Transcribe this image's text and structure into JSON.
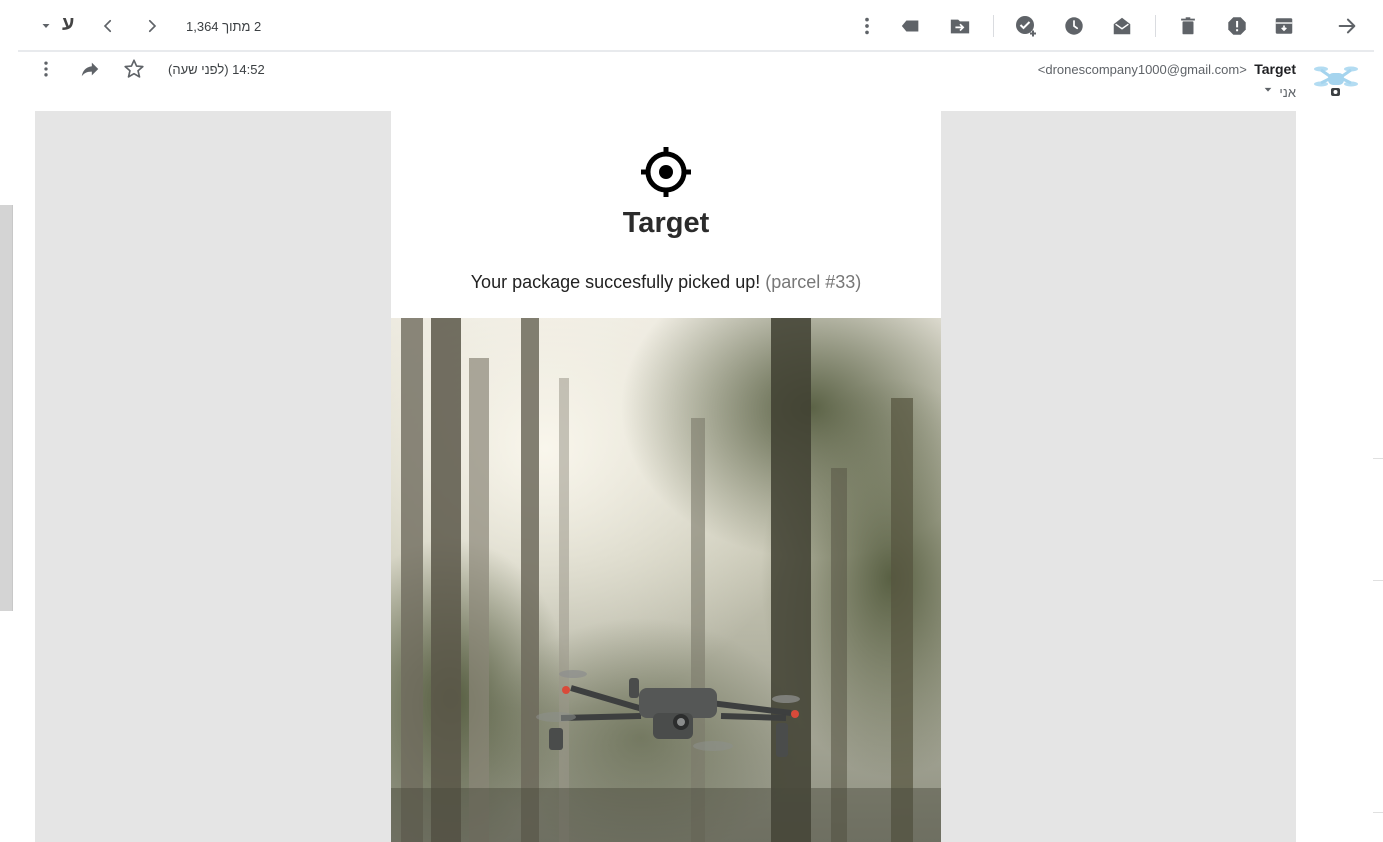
{
  "toolbar": {
    "pagination": "2 מתוך 1,364",
    "input_tool_label": "ע",
    "icons": [
      "back-arrow-icon",
      "archive-icon",
      "report-spam-icon",
      "delete-icon",
      "mark-unread-icon",
      "snooze-icon",
      "add-task-icon",
      "move-to-icon",
      "label-icon",
      "more-vert-icon"
    ]
  },
  "header": {
    "sender_name": "Target",
    "sender_email": "<dronescompany1000@gmail.com>",
    "recipient": "אני",
    "time": "14:52 (לפני שעה)"
  },
  "email": {
    "brand_title": "Target",
    "message": "Your package succesfully picked up!",
    "parcel": "(parcel #33)",
    "logo_icon": "crosshair-target-icon",
    "image": "drone-forest-photo"
  },
  "colors": {
    "toolbar_icon": "#5f6368",
    "mail_background": "#e5e5e5",
    "parcel_text": "#777777"
  }
}
